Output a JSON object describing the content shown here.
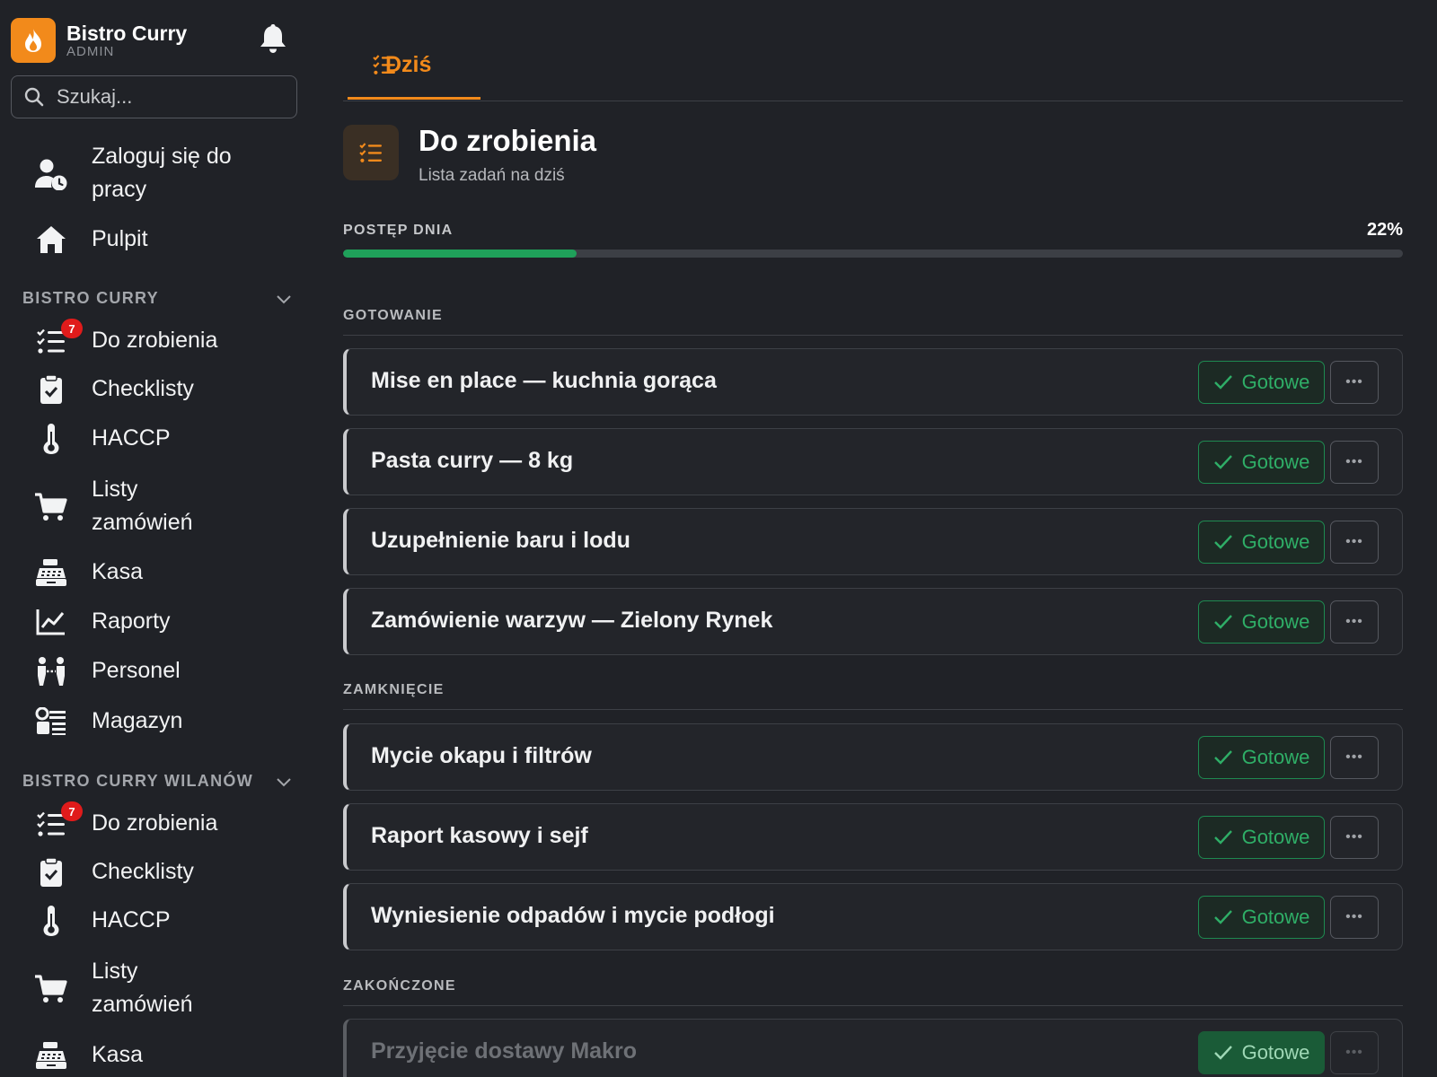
{
  "brand": {
    "name": "Bistro Curry",
    "role": "ADMIN"
  },
  "search": {
    "placeholder": "Szukaj..."
  },
  "nav_top": [
    {
      "label": "Zaloguj się do pracy",
      "icon": "user-clock-icon"
    },
    {
      "label": "Pulpit",
      "icon": "home-icon"
    }
  ],
  "sections": [
    {
      "title": "BISTRO CURRY",
      "items": [
        {
          "label": "Do zrobienia",
          "icon": "tasks-icon",
          "badge": "7"
        },
        {
          "label": "Checklisty",
          "icon": "clipboard-check-icon"
        },
        {
          "label": "HACCP",
          "icon": "thermometer-icon"
        },
        {
          "label": "Listy zamówień",
          "icon": "cart-icon"
        },
        {
          "label": "Kasa",
          "icon": "cash-register-icon"
        },
        {
          "label": "Raporty",
          "icon": "chart-line-icon"
        },
        {
          "label": "Personel",
          "icon": "people-icon"
        },
        {
          "label": "Magazyn",
          "icon": "warehouse-icon"
        }
      ]
    },
    {
      "title": "BISTRO CURRY WILANÓW",
      "items": [
        {
          "label": "Do zrobienia",
          "icon": "tasks-icon",
          "badge": "7"
        },
        {
          "label": "Checklisty",
          "icon": "clipboard-check-icon"
        },
        {
          "label": "HACCP",
          "icon": "thermometer-icon"
        },
        {
          "label": "Listy zamówień",
          "icon": "cart-icon"
        },
        {
          "label": "Kasa",
          "icon": "cash-register-icon"
        }
      ]
    }
  ],
  "tab": {
    "label": "Dziś"
  },
  "header": {
    "title": "Do zrobienia",
    "subtitle": "Lista zadań na dziś"
  },
  "progress": {
    "label": "POSTĘP DNIA",
    "value_text": "22%",
    "fraction": 0.22
  },
  "groups": [
    {
      "title": "GOTOWANIE",
      "tasks": [
        {
          "title": "Mise en place — kuchnia gorąca",
          "button": "Gotowe"
        },
        {
          "title": "Pasta curry — 8 kg",
          "button": "Gotowe"
        },
        {
          "title": "Uzupełnienie baru i lodu",
          "button": "Gotowe"
        },
        {
          "title": "Zamówienie warzyw — Zielony Rynek",
          "button": "Gotowe"
        }
      ]
    },
    {
      "title": "ZAMKNIĘCIE",
      "tasks": [
        {
          "title": "Mycie okapu i filtrów",
          "button": "Gotowe"
        },
        {
          "title": "Raport kasowy i sejf",
          "button": "Gotowe"
        },
        {
          "title": "Wyniesienie odpadów i mycie podłogi",
          "button": "Gotowe"
        }
      ]
    },
    {
      "title": "ZAKOŃCZONE",
      "tasks": [
        {
          "title": "Przyjęcie dostawy Makro",
          "button": "Gotowe",
          "completed": true
        }
      ]
    }
  ],
  "colors": {
    "accent": "#f28a1b",
    "success": "#1fa15a",
    "badge": "#e01b1b",
    "background": "#202227"
  }
}
